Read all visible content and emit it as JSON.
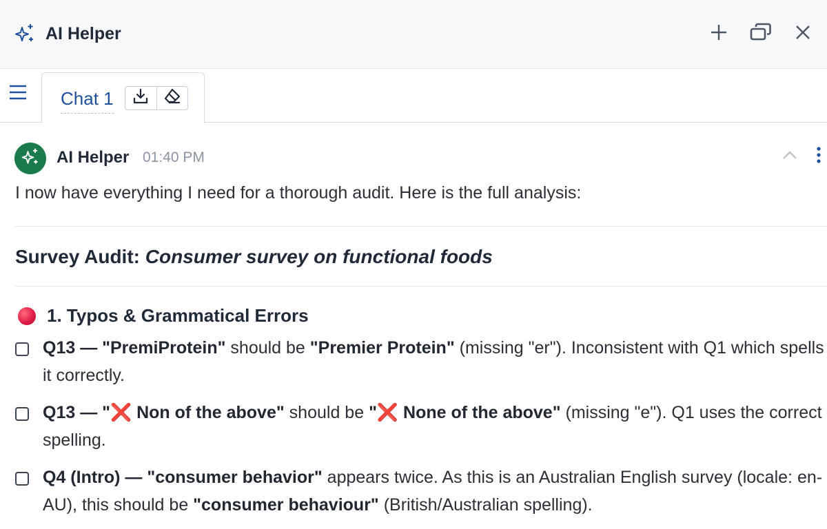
{
  "window": {
    "title": "AI Helper",
    "icons": {
      "app": "sparkle-icon",
      "add": "plus-icon",
      "restore": "restore-window-icon",
      "close": "close-icon"
    }
  },
  "tabs": {
    "menu_icon": "hamburger-menu-icon",
    "active_tab": {
      "label": "Chat 1",
      "export_icon": "download-icon",
      "clear_icon": "eraser-icon"
    }
  },
  "message": {
    "sender": "AI Helper",
    "time": "01:40 PM",
    "intro": "I now have everything I need for a thorough audit. Here is the full analysis:",
    "heading_prefix": "Survey Audit: ",
    "heading_subject": "Consumer survey on functional foods",
    "section_title": "1. Typos & Grammatical Errors",
    "items": [
      {
        "bold1": "Q13 — \"PremiProtein\"",
        "text1": " should be ",
        "bold2": "\"Premier Protein\"",
        "text2": " (missing \"er\"). Inconsistent with Q1 which spells it correctly."
      },
      {
        "bold1a": "Q13 — \"",
        "mark1": "❌",
        "bold1b": " Non of the above\"",
        "text1": " should be ",
        "bold2a": "\"",
        "mark2": "❌",
        "bold2b": " None of the above\"",
        "text2": " (missing \"e\"). Q1 uses the correct spelling."
      },
      {
        "bold1": "Q4 (Intro) — \"consumer behavior\"",
        "text1": " appears twice. As this is an Australian English survey (locale: en-AU), this should be ",
        "bold2": "\"consumer behaviour\"",
        "text2": " (British/Australian spelling)."
      }
    ]
  },
  "colors": {
    "avatar_bg": "#1b7a4c",
    "tab_label": "#1e4f9c",
    "status_dot": "#e11d48",
    "cross_mark": "#e53950"
  }
}
